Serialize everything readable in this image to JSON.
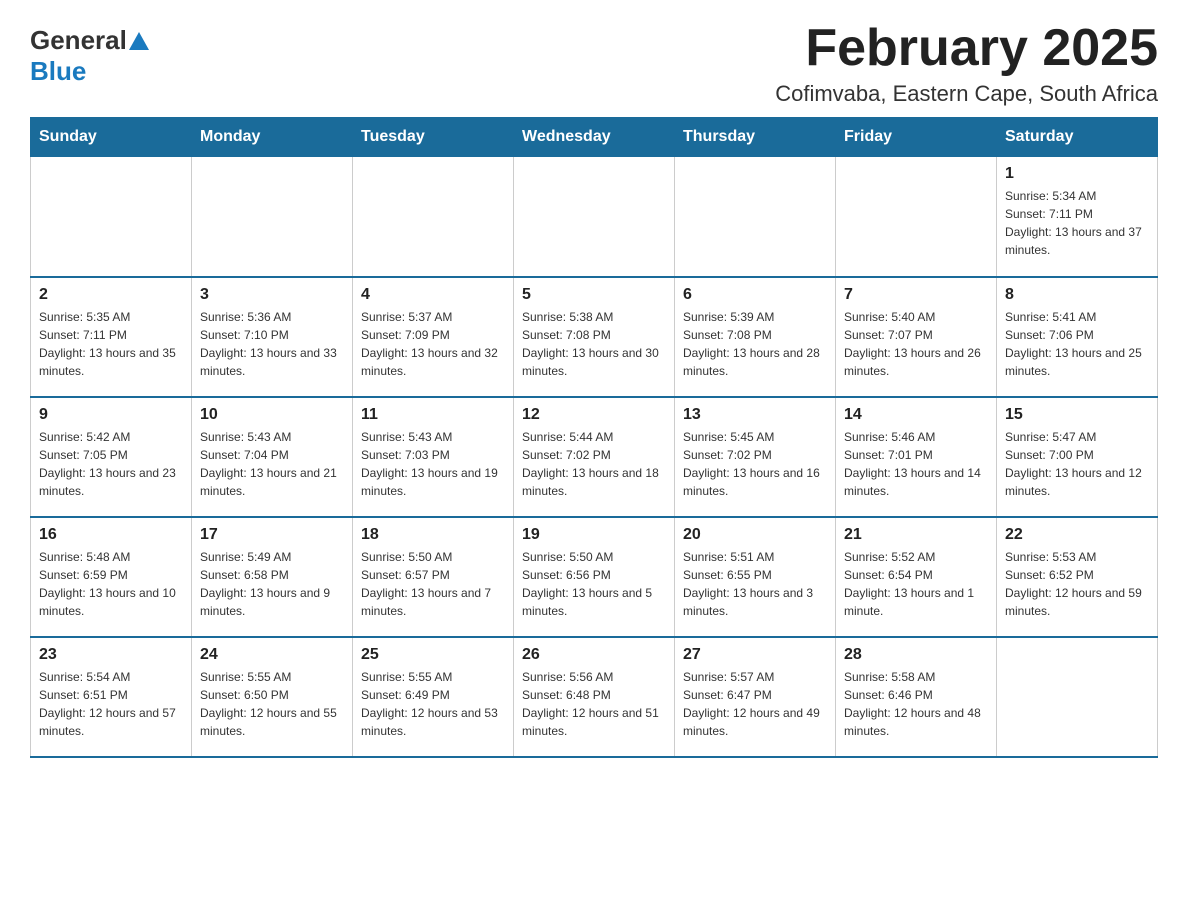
{
  "header": {
    "logo_general": "General",
    "logo_blue": "Blue",
    "month_title": "February 2025",
    "location": "Cofimvaba, Eastern Cape, South Africa"
  },
  "days_of_week": [
    "Sunday",
    "Monday",
    "Tuesday",
    "Wednesday",
    "Thursday",
    "Friday",
    "Saturday"
  ],
  "weeks": [
    [
      {
        "day": "",
        "info": ""
      },
      {
        "day": "",
        "info": ""
      },
      {
        "day": "",
        "info": ""
      },
      {
        "day": "",
        "info": ""
      },
      {
        "day": "",
        "info": ""
      },
      {
        "day": "",
        "info": ""
      },
      {
        "day": "1",
        "info": "Sunrise: 5:34 AM\nSunset: 7:11 PM\nDaylight: 13 hours and 37 minutes."
      }
    ],
    [
      {
        "day": "2",
        "info": "Sunrise: 5:35 AM\nSunset: 7:11 PM\nDaylight: 13 hours and 35 minutes."
      },
      {
        "day": "3",
        "info": "Sunrise: 5:36 AM\nSunset: 7:10 PM\nDaylight: 13 hours and 33 minutes."
      },
      {
        "day": "4",
        "info": "Sunrise: 5:37 AM\nSunset: 7:09 PM\nDaylight: 13 hours and 32 minutes."
      },
      {
        "day": "5",
        "info": "Sunrise: 5:38 AM\nSunset: 7:08 PM\nDaylight: 13 hours and 30 minutes."
      },
      {
        "day": "6",
        "info": "Sunrise: 5:39 AM\nSunset: 7:08 PM\nDaylight: 13 hours and 28 minutes."
      },
      {
        "day": "7",
        "info": "Sunrise: 5:40 AM\nSunset: 7:07 PM\nDaylight: 13 hours and 26 minutes."
      },
      {
        "day": "8",
        "info": "Sunrise: 5:41 AM\nSunset: 7:06 PM\nDaylight: 13 hours and 25 minutes."
      }
    ],
    [
      {
        "day": "9",
        "info": "Sunrise: 5:42 AM\nSunset: 7:05 PM\nDaylight: 13 hours and 23 minutes."
      },
      {
        "day": "10",
        "info": "Sunrise: 5:43 AM\nSunset: 7:04 PM\nDaylight: 13 hours and 21 minutes."
      },
      {
        "day": "11",
        "info": "Sunrise: 5:43 AM\nSunset: 7:03 PM\nDaylight: 13 hours and 19 minutes."
      },
      {
        "day": "12",
        "info": "Sunrise: 5:44 AM\nSunset: 7:02 PM\nDaylight: 13 hours and 18 minutes."
      },
      {
        "day": "13",
        "info": "Sunrise: 5:45 AM\nSunset: 7:02 PM\nDaylight: 13 hours and 16 minutes."
      },
      {
        "day": "14",
        "info": "Sunrise: 5:46 AM\nSunset: 7:01 PM\nDaylight: 13 hours and 14 minutes."
      },
      {
        "day": "15",
        "info": "Sunrise: 5:47 AM\nSunset: 7:00 PM\nDaylight: 13 hours and 12 minutes."
      }
    ],
    [
      {
        "day": "16",
        "info": "Sunrise: 5:48 AM\nSunset: 6:59 PM\nDaylight: 13 hours and 10 minutes."
      },
      {
        "day": "17",
        "info": "Sunrise: 5:49 AM\nSunset: 6:58 PM\nDaylight: 13 hours and 9 minutes."
      },
      {
        "day": "18",
        "info": "Sunrise: 5:50 AM\nSunset: 6:57 PM\nDaylight: 13 hours and 7 minutes."
      },
      {
        "day": "19",
        "info": "Sunrise: 5:50 AM\nSunset: 6:56 PM\nDaylight: 13 hours and 5 minutes."
      },
      {
        "day": "20",
        "info": "Sunrise: 5:51 AM\nSunset: 6:55 PM\nDaylight: 13 hours and 3 minutes."
      },
      {
        "day": "21",
        "info": "Sunrise: 5:52 AM\nSunset: 6:54 PM\nDaylight: 13 hours and 1 minute."
      },
      {
        "day": "22",
        "info": "Sunrise: 5:53 AM\nSunset: 6:52 PM\nDaylight: 12 hours and 59 minutes."
      }
    ],
    [
      {
        "day": "23",
        "info": "Sunrise: 5:54 AM\nSunset: 6:51 PM\nDaylight: 12 hours and 57 minutes."
      },
      {
        "day": "24",
        "info": "Sunrise: 5:55 AM\nSunset: 6:50 PM\nDaylight: 12 hours and 55 minutes."
      },
      {
        "day": "25",
        "info": "Sunrise: 5:55 AM\nSunset: 6:49 PM\nDaylight: 12 hours and 53 minutes."
      },
      {
        "day": "26",
        "info": "Sunrise: 5:56 AM\nSunset: 6:48 PM\nDaylight: 12 hours and 51 minutes."
      },
      {
        "day": "27",
        "info": "Sunrise: 5:57 AM\nSunset: 6:47 PM\nDaylight: 12 hours and 49 minutes."
      },
      {
        "day": "28",
        "info": "Sunrise: 5:58 AM\nSunset: 6:46 PM\nDaylight: 12 hours and 48 minutes."
      },
      {
        "day": "",
        "info": ""
      }
    ]
  ]
}
